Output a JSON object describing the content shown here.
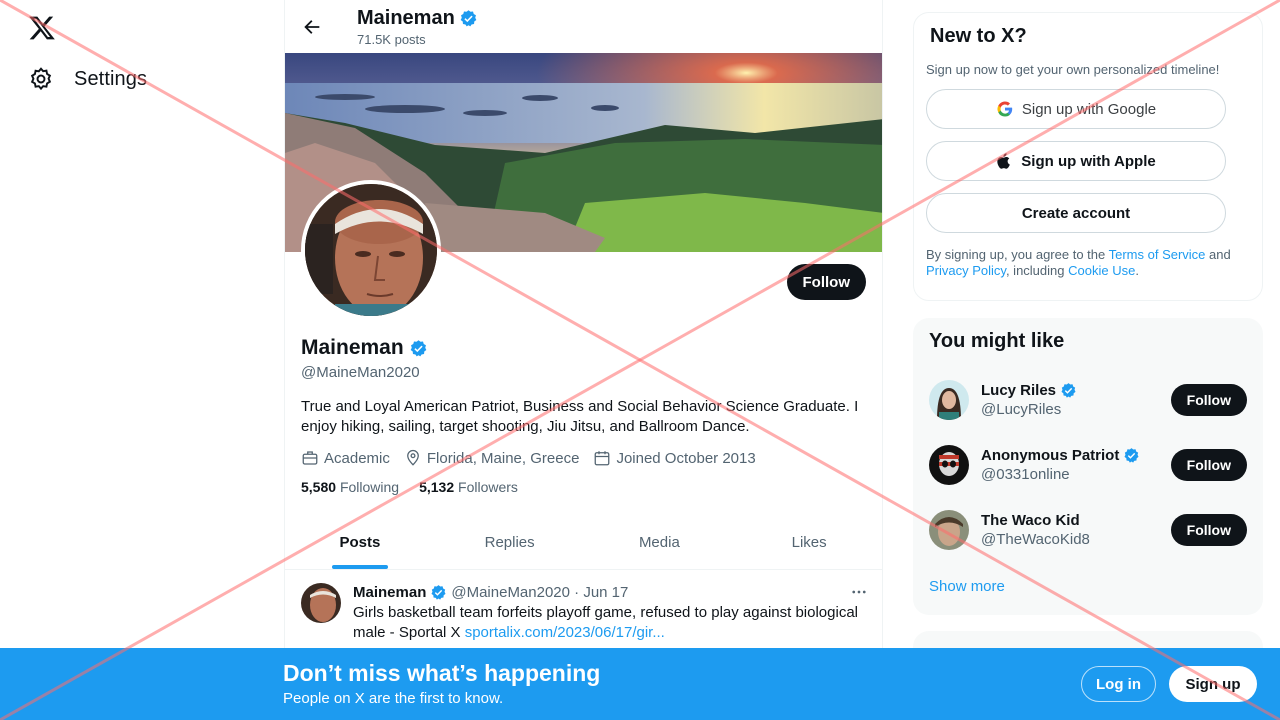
{
  "nav": {
    "settings_label": "Settings"
  },
  "profile": {
    "name": "Maineman",
    "posts_count": "71.5K posts",
    "handle": "@MaineMan2020",
    "bio": "True and Loyal American Patriot, Business and Social Behavior Science Graduate. I enjoy hiking, sailing, target shooting, Jiu Jitsu, and Ballroom Dance.",
    "category": "Academic",
    "location": "Florida, Maine, Greece",
    "joined": "Joined October 2013",
    "following_count": "5,580",
    "following_label": "Following",
    "followers_count": "5,132",
    "followers_label": "Followers",
    "follow_label": "Follow"
  },
  "tabs": [
    "Posts",
    "Replies",
    "Media",
    "Likes"
  ],
  "post": {
    "name": "Maineman",
    "handle_date": "@MaineMan2020 · Jun 17",
    "text": "Girls basketball team forfeits playoff game, refused to play against biological male - Sportal X ",
    "link": "sportalix.com/2023/06/17/gir..."
  },
  "new_to_x": {
    "title": "New to X?",
    "subtitle": "Sign up now to get your own personalized timeline!",
    "google_label": "Sign up with Google",
    "apple_label": "Sign up with Apple",
    "create_label": "Create account",
    "terms_prefix": "By signing up, you agree to the ",
    "terms_link": "Terms of Service",
    "terms_and": " and ",
    "privacy_link": "Privacy Policy",
    "terms_including": ", including ",
    "cookie_link": "Cookie Use",
    "terms_end": "."
  },
  "you_might_like": {
    "title": "You might like",
    "users": [
      {
        "name": "Lucy Riles",
        "handle": "@LucyRiles",
        "verified": true,
        "follow_label": "Follow"
      },
      {
        "name": "Anonymous Patriot",
        "handle": "@0331online",
        "verified": true,
        "follow_label": "Follow"
      },
      {
        "name": "The Waco Kid",
        "handle": "@TheWacoKid8",
        "verified": false,
        "follow_label": "Follow"
      }
    ],
    "show_more": "Show more"
  },
  "bottom_bar": {
    "title": "Don’t miss what’s happening",
    "subtitle": "People on X are the first to know.",
    "login_label": "Log in",
    "signup_label": "Sign up"
  },
  "colors": {
    "accent": "#1d9bf0",
    "text": "#0f1419",
    "muted": "#536471",
    "overlay": "#ff6b6b"
  }
}
